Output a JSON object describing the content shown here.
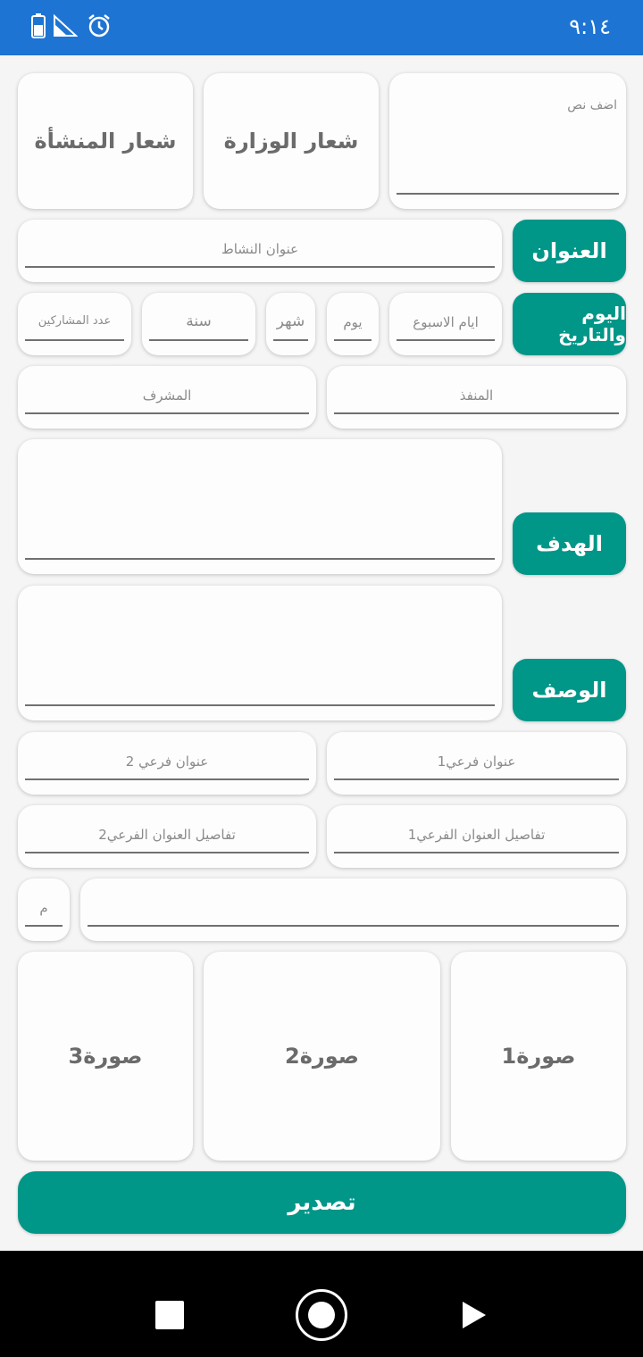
{
  "status_bar": {
    "time": "٩:١٤",
    "icons": [
      "battery-saver-icon",
      "signal-icon",
      "alarm-icon"
    ]
  },
  "form": {
    "add_text_placeholder": "اضف نص",
    "ministry_logo": "شعار الوزارة",
    "facility_logo": "شعار المنشأة",
    "title_label": "العنوان",
    "title_placeholder": "عنوان النشاط",
    "date_label": "اليوم والتاريخ",
    "weekday_placeholder": "ايام الاسبوع",
    "day_placeholder": "يوم",
    "month_placeholder": "شهر",
    "year_placeholder": "سنة",
    "participants_placeholder": "عدد المشاركين",
    "executor_placeholder": "المنفذ",
    "supervisor_placeholder": "المشرف",
    "goal_label": "الهدف",
    "description_label": "الوصف",
    "subtitle1_placeholder": "عنوان فرعي1",
    "subtitle2_placeholder": "عنوان فرعي 2",
    "subtitle1_details_placeholder": "تفاصيل العنوان الفرعي1",
    "subtitle2_details_placeholder": "تفاصيل العنوان الفرعي2",
    "number_placeholder": "م",
    "image1": "صورة1",
    "image2": "صورة2",
    "image3": "صورة3",
    "export_button": "تصدير"
  },
  "colors": {
    "status_bar": "#1e74d2",
    "accent": "#009688",
    "background": "#f5f5f5"
  }
}
